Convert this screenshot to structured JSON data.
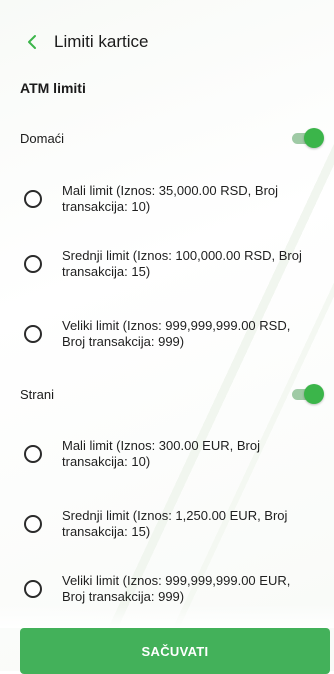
{
  "header": {
    "back_icon": "chevron-left-icon",
    "title": "Limiti kartice"
  },
  "section_title": "ATM limiti",
  "accent_color": "#3bb54a",
  "groups": [
    {
      "label": "Domaći",
      "enabled": true,
      "options": [
        {
          "label": "Mali limit (Iznos: 35,000.00 RSD, Broj transakcija: 10)",
          "selected": false
        },
        {
          "label": "Srednji limit (Iznos: 100,000.00 RSD, Broj transakcija: 15)",
          "selected": false
        },
        {
          "label": "Veliki limit (Iznos: 999,999,999.00 RSD, Broj transakcija: 999)",
          "selected": false
        }
      ]
    },
    {
      "label": "Strani",
      "enabled": true,
      "options": [
        {
          "label": "Mali limit (Iznos: 300.00 EUR, Broj transakcija: 10)",
          "selected": false
        },
        {
          "label": "Srednji limit (Iznos: 1,250.00 EUR, Broj transakcija: 15)",
          "selected": false
        },
        {
          "label": "Veliki limit (Iznos: 999,999,999.00 EUR, Broj transakcija: 999)",
          "selected": false
        }
      ]
    }
  ],
  "save_button": "SAČUVATI"
}
